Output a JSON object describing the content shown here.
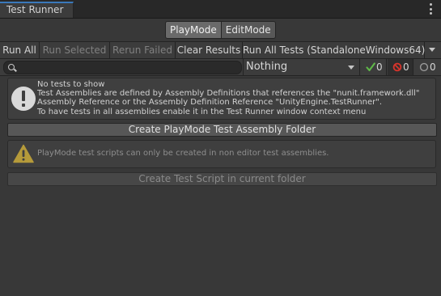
{
  "window": {
    "tab_title": "Test Runner",
    "menu_icon": "kebab-menu-icon"
  },
  "mode": {
    "playmode_label": "PlayMode",
    "editmode_label": "EditMode",
    "active": "PlayMode"
  },
  "toolbar": {
    "run_all": "Run All",
    "run_selected": "Run Selected",
    "rerun_failed": "Rerun Failed",
    "clear_results": "Clear Results",
    "run_all_tests": "Run All Tests (StandaloneWindows64)"
  },
  "filter": {
    "search_value": "",
    "category_value": "Nothing",
    "passed_count": "0",
    "failed_count": "0",
    "notrun_count": "0",
    "colors": {
      "passed": "#5fb848",
      "failed": "#d9342b",
      "notrun": "#9a9a9a"
    }
  },
  "info": {
    "line1": "No tests to show",
    "line2": "Test Assemblies are defined by Assembly Definitions that references the \"nunit.framework.dll\"",
    "line3": "Assembly Reference or the Assembly Definition Reference \"UnityEngine.TestRunner\".",
    "line4": "To have tests in all assemblies enable it in the Test Runner window context menu"
  },
  "create_assembly_button": "Create PlayMode Test Assembly Folder",
  "warning": {
    "text": "PlayMode test scripts can only be created in non editor test assemblies.",
    "icon_color": "#b59a3a"
  },
  "create_script_button": "Create Test Script in current folder"
}
